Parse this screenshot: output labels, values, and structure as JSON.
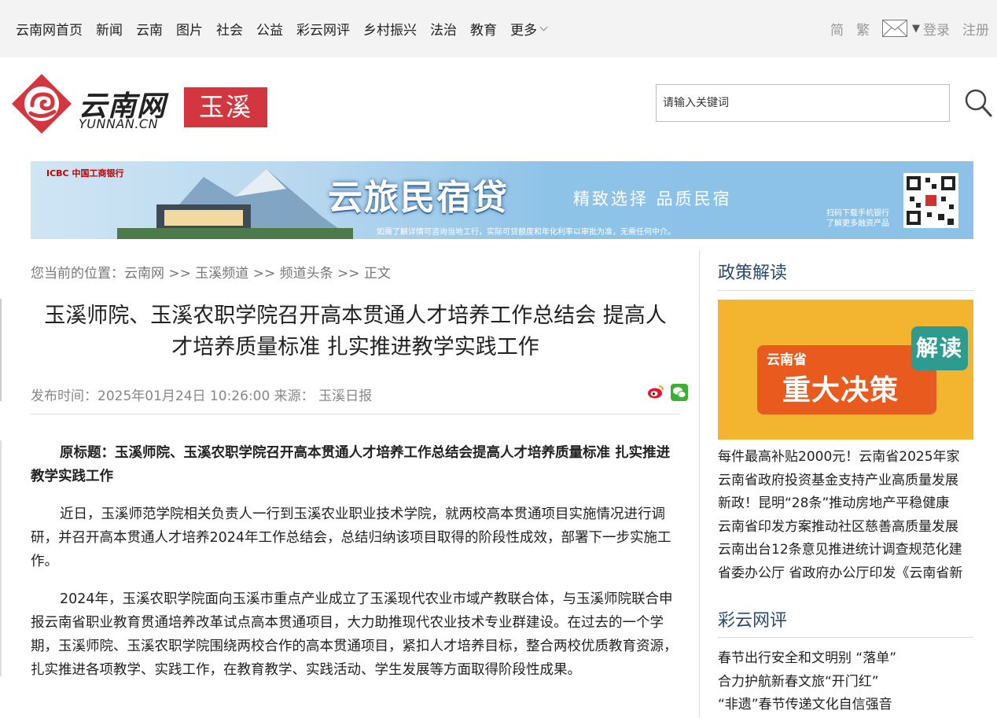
{
  "nav": {
    "items": [
      "云南网首页",
      "新闻",
      "云南",
      "图片",
      "社会",
      "公益",
      "彩云网评",
      "乡村振兴",
      "法治",
      "教育"
    ],
    "more": "更多"
  },
  "tools": {
    "simplified": "简",
    "traditional": "繁",
    "login": "登录",
    "register": "注册"
  },
  "brand": {
    "name_cn": "云南网",
    "name_en": "YUNNAN.CN",
    "city": "玉溪"
  },
  "search": {
    "placeholder": "请输入关键词"
  },
  "banner": {
    "bank": "ICBC 中国工商银行",
    "title": "云旅民宿贷",
    "slogan": "精致选择 品质民宿",
    "note": "如需了解详情可咨询当地工行，实际可贷额度和年化利率以审批为准，无需任何中介。",
    "qr_text_1": "扫码下载手机银行",
    "qr_text_2": "了解更多融资产品"
  },
  "breadcrumb": "您当前的位置：云南网 >> 玉溪频道 >> 频道头条 >> 正文",
  "article": {
    "title_line1": "玉溪师院、玉溪农职学院召开高本贯通人才培养工作总结会 提高人",
    "title_line2": "才培养质量标准 扎实推进教学实践工作",
    "meta": "发布时间：2025年01月24日 10:26:00  来源： 玉溪日报",
    "p1": "原标题：玉溪师院、玉溪农职学院召开高本贯通人才培养工作总结会提高人才培养质量标准 扎实推进教学实践工作",
    "p2": "近日，玉溪师范学院相关负责人一行到玉溪农业职业技术学院，就两校高本贯通项目实施情况进行调研，并召开高本贯通人才培养2024年工作总结会，总结归纳该项目取得的阶段性成效，部署下一步实施工作。",
    "p3": "2024年，玉溪农职学院面向玉溪市重点产业成立了玉溪现代农业市域产教联合体，与玉溪师院联合申报云南省职业教育贯通培养改革试点高本贯通项目，大力助推现代农业技术专业群建设。在过去的一个学期，玉溪师院、玉溪农职学院围绕两校合作的高本贯通项目，紧扣人才培养目标，整合两校优质教育资源，扎实推进各项教学、实践工作，在教育教学、实践活动、学生发展等方面取得阶段性成果。"
  },
  "sidebar": {
    "policy_title": "政策解读",
    "policy_img": {
      "small": "云南省",
      "big": "重大决策",
      "tag": "解读"
    },
    "policy_items": [
      "每件最高补贴2000元！云南省2025年家",
      "云南省政府投资基金支持产业高质量发展",
      "新政！昆明“28条”推动房地产平稳健康",
      "云南省印发方案推动社区慈善高质量发展",
      "云南出台12条意见推进统计调查规范化建",
      "省委办公厅 省政府办公厅印发《云南省新"
    ],
    "review_title": "彩云网评",
    "review_items": [
      "春节出行安全和文明别 “落单”",
      "合力护航新春文旅“开门红”",
      "“非遗”春节传递文化自信强音"
    ]
  },
  "colors": {
    "brand_red": "#d4363f",
    "link_blue": "#2b4a6b",
    "topbar": "#f3f3f3"
  }
}
